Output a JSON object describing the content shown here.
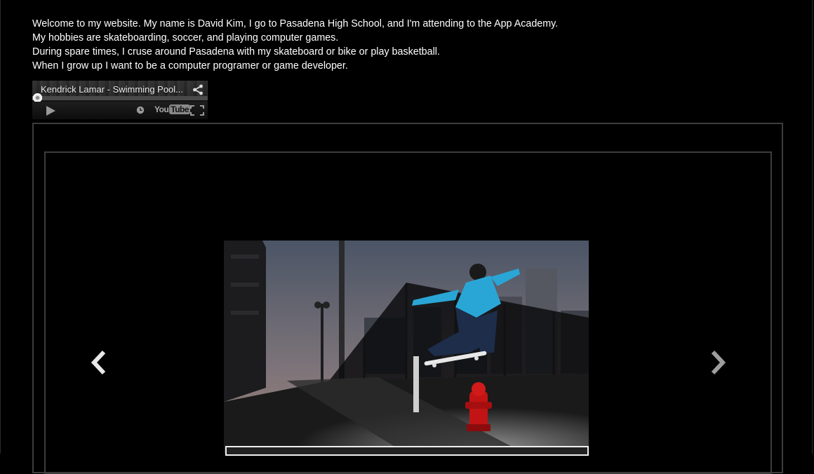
{
  "intro": {
    "lines": [
      "Welcome to my website. My name is David Kim, I go to Pasadena High School, and I'm attending to the App Academy.",
      "My hobbies are skateboarding, soccer, and playing computer games.",
      "During spare times, I cruse around Pasadena with my skateboard or bike or play basketball.",
      "When I grow up I want to be a computer programer or game developer."
    ]
  },
  "video": {
    "title": "Kendrick Lamar - Swimming Pool...",
    "logo_you": "You",
    "logo_tube": "Tube",
    "progress_fraction": 0.02
  },
  "carousel": {
    "current_slide_subject": "skateboarder ollie over fire hydrant at dusk",
    "prev_icon": "chevron-left-icon",
    "next_icon": "chevron-right-icon"
  },
  "colors": {
    "background": "#000000",
    "text": "#ffffff",
    "frame_border": "#3d3d3d",
    "arrow": "#cfcfcf"
  }
}
